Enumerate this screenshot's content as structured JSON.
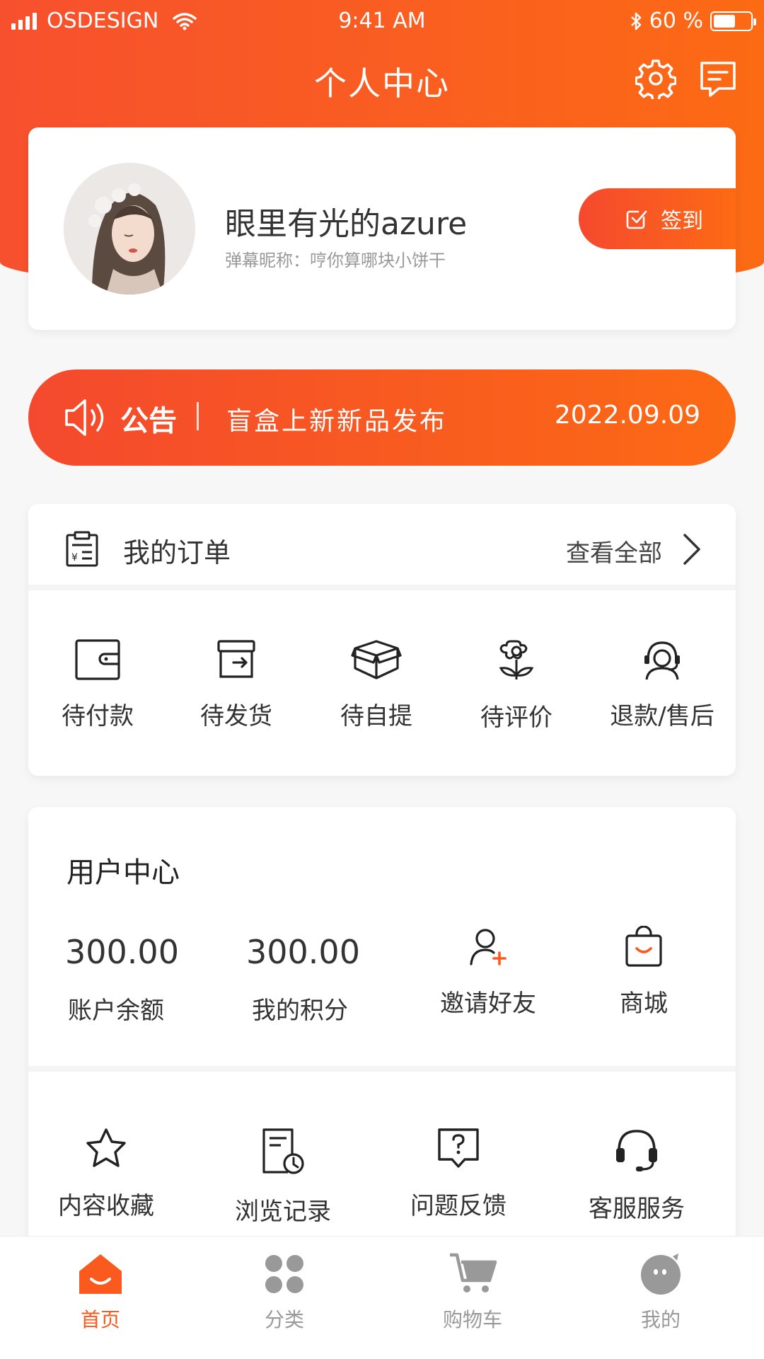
{
  "status_bar": {
    "carrier": "OSDESIGN",
    "time": "9:41 AM",
    "battery": "60 %",
    "battery_level": 0.6
  },
  "header": {
    "title": "个人中心",
    "settings_icon": "gear-icon",
    "message_icon": "message-icon"
  },
  "profile": {
    "username": "眼里有光的azure",
    "nickname": "弹幕昵称：哼你算哪块小饼干",
    "signin_label": "签到"
  },
  "notice": {
    "title": "公告",
    "text": "盲盒上新新品发布",
    "date": "2022.09.09"
  },
  "orders": {
    "title": "我的订单",
    "view_all": "查看全部",
    "items": [
      {
        "label": "待付款",
        "icon": "wallet-icon"
      },
      {
        "label": "待发货",
        "icon": "box-out-icon"
      },
      {
        "label": "待自提",
        "icon": "package-icon"
      },
      {
        "label": "待评价",
        "icon": "flower-icon"
      },
      {
        "label": "退款/售后",
        "icon": "service-agent-icon"
      }
    ]
  },
  "user_center": {
    "title": "用户中心",
    "balance": {
      "value": "300.00",
      "label": "账户余额"
    },
    "points": {
      "value": "300.00",
      "label": "我的积分"
    },
    "invite_label": "邀请好友",
    "mall_label": "商城",
    "tools": [
      {
        "label": "内容收藏",
        "icon": "star-icon"
      },
      {
        "label": "浏览记录",
        "icon": "history-icon"
      },
      {
        "label": "问题反馈",
        "icon": "feedback-icon"
      },
      {
        "label": "客服服务",
        "icon": "headset-icon"
      }
    ]
  },
  "tabbar": {
    "items": [
      {
        "label": "首页",
        "icon": "home-icon",
        "active": true
      },
      {
        "label": "分类",
        "icon": "category-icon",
        "active": false
      },
      {
        "label": "购物车",
        "icon": "cart-icon",
        "active": false
      },
      {
        "label": "我的",
        "icon": "profile-icon",
        "active": false
      }
    ]
  },
  "colors": {
    "accent": "#fa5a1e",
    "gradient_start": "#f4492e",
    "gradient_end": "#fc6a14"
  }
}
